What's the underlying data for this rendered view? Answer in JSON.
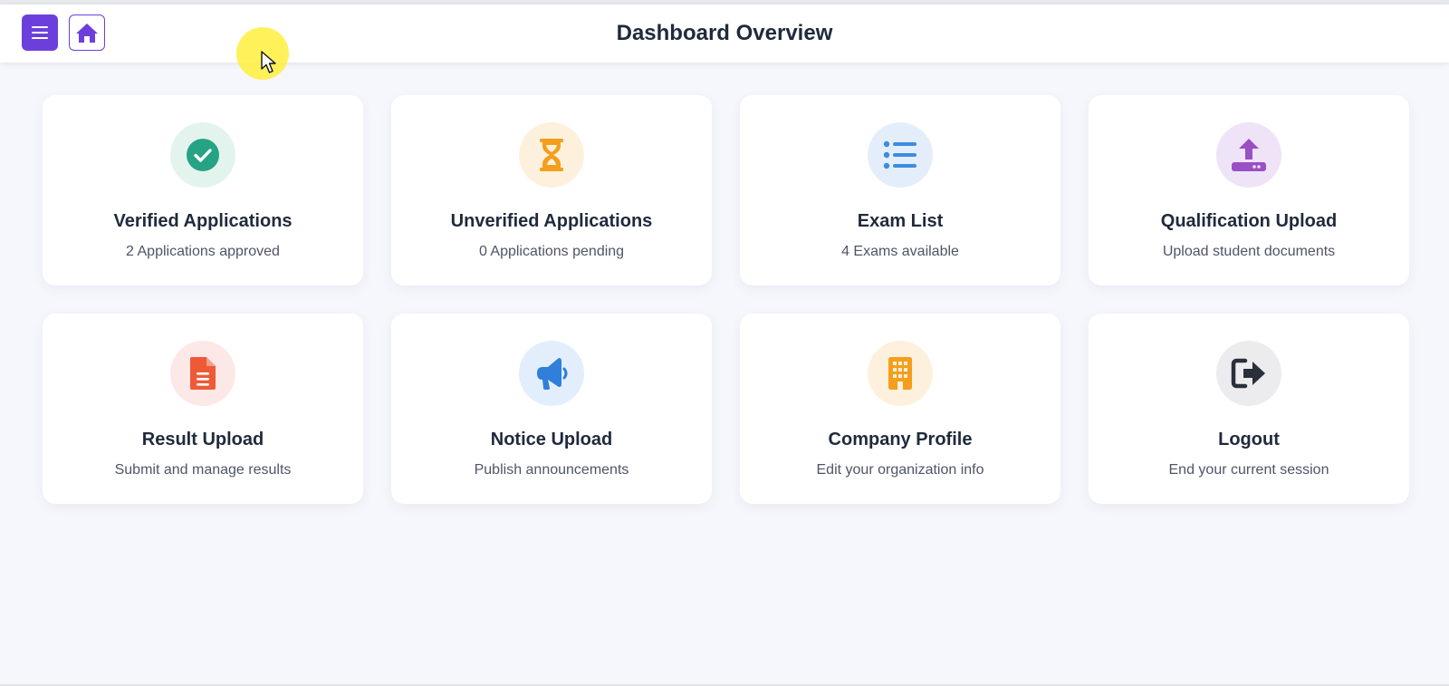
{
  "header": {
    "title": "Dashboard Overview",
    "menu_icon": "menu-icon",
    "home_icon": "home-icon"
  },
  "colors": {
    "accent": "#6c3fdc",
    "background": "#f6f7fc",
    "card": "#ffffff",
    "cursor_highlight": "#ffee3c"
  },
  "cards": [
    {
      "title": "Verified Applications",
      "subtitle": "2 Applications approved",
      "icon": "check-circle-icon",
      "icon_color": "#26a384",
      "icon_bg": "#e3f4ef"
    },
    {
      "title": "Unverified Applications",
      "subtitle": "0 Applications pending",
      "icon": "hourglass-icon",
      "icon_color": "#f59e1b",
      "icon_bg": "#fdf1de"
    },
    {
      "title": "Exam List",
      "subtitle": "4 Exams available",
      "icon": "list-icon",
      "icon_color": "#3b8de0",
      "icon_bg": "#e4eefa"
    },
    {
      "title": "Qualification Upload",
      "subtitle": "Upload student documents",
      "icon": "upload-icon",
      "icon_color": "#9a4fc4",
      "icon_bg": "#efe3f8"
    },
    {
      "title": "Result Upload",
      "subtitle": "Submit and manage results",
      "icon": "file-icon",
      "icon_color": "#ee5a36",
      "icon_bg": "#fce8e6"
    },
    {
      "title": "Notice Upload",
      "subtitle": "Publish announcements",
      "icon": "megaphone-icon",
      "icon_color": "#2f7fdb",
      "icon_bg": "#e2eefb"
    },
    {
      "title": "Company Profile",
      "subtitle": "Edit your organization info",
      "icon": "building-icon",
      "icon_color": "#f59e1b",
      "icon_bg": "#fdf1de"
    },
    {
      "title": "Logout",
      "subtitle": "End your current session",
      "icon": "logout-icon",
      "icon_color": "#2a2f3a",
      "icon_bg": "#ececef"
    }
  ]
}
